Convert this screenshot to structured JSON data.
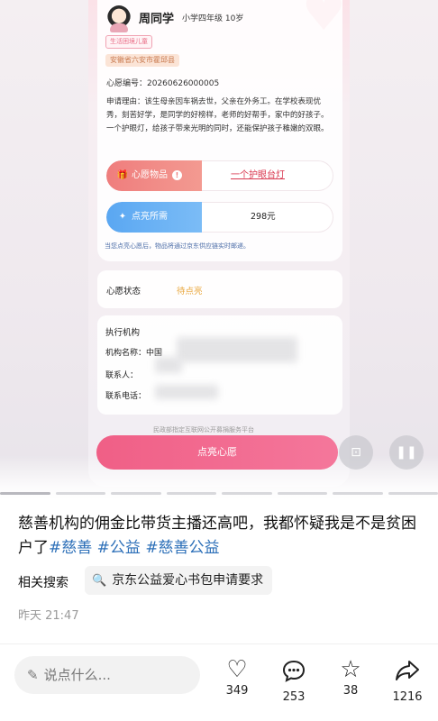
{
  "video": {
    "student_name": "周同学",
    "grade": "小学四年级 10岁",
    "tag_project": "生活困境儿童",
    "tag_location": "安徽省六安市霍邱县",
    "wish_no": "心愿编号：20260626000005",
    "reason": "申请理由：该生母亲因车祸去世，父亲在外务工。在学校表现优秀，刻苦好学，是同学的好榜样，老师的好帮手，家中的好孩子。一个护眼灯，给孩子带来光明的同时，还能保护孩子稚嫩的双眼。",
    "wish_item_label": "心愿物品",
    "wish_item_value": "一个护眼台灯",
    "price_label": "点亮所需",
    "price_value": "298元",
    "delivery_note": "当您点亮心愿后，物品将通过京东供应链实时邮递。",
    "status_label": "心愿状态",
    "status_value": "待点亮",
    "org_title": "执行机构",
    "org_name_label": "机构名称：中国",
    "contact_label": "联系人：",
    "phone_label": "联系电话：",
    "platform_note": "民政部指定互联网公开募捐服务平台",
    "cta_label": "点亮心愿",
    "screenshot_icon": "screenshot-icon",
    "pause_icon": "pause-icon"
  },
  "post": {
    "caption_text": "慈善机构的佣金比带货主播还高吧，我都怀疑我是不是贫困户了",
    "hashtags": [
      "#慈善",
      "#公益",
      "#慈善公益"
    ],
    "related_label": "相关搜索",
    "related_query": "京东公益爱心书包申请要求",
    "time": "昨天 21:47"
  },
  "bottom_bar": {
    "comment_placeholder": "说点什么...",
    "likes": "349",
    "comments": "253",
    "favorites": "38",
    "shares": "1216"
  },
  "colors": {
    "cta": "#f05f86",
    "hashtag": "#2c6fb8",
    "status_pending": "#e8a437",
    "wish_item_accent": "#ef7d7d",
    "price_accent": "#5aa7f2"
  }
}
